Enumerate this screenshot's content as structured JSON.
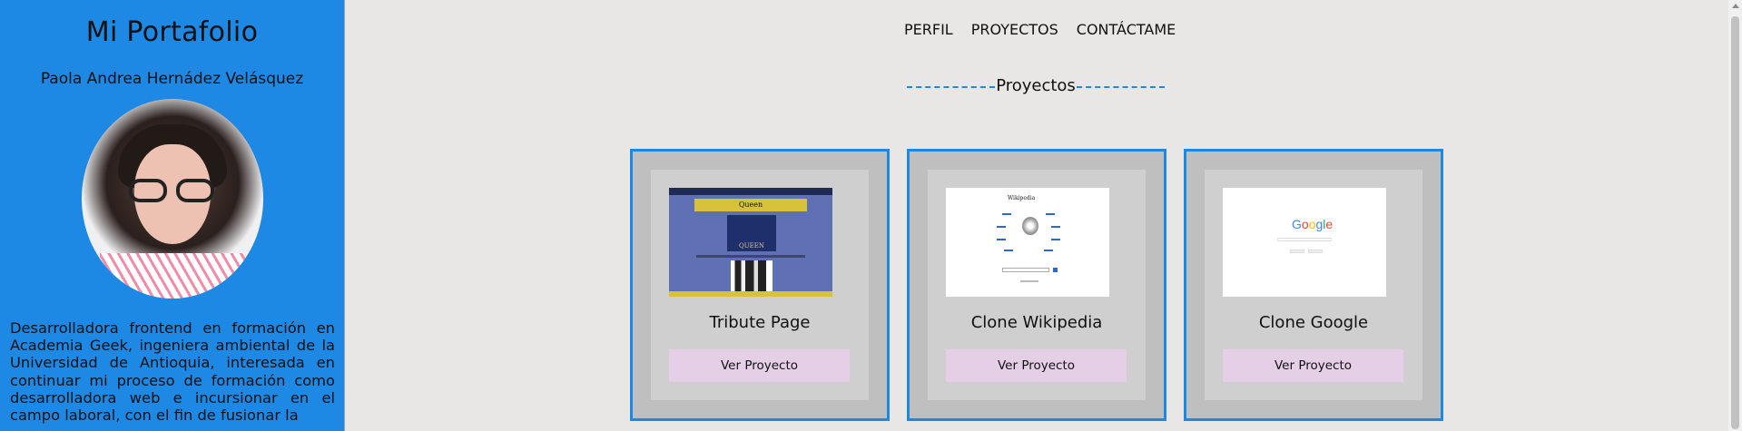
{
  "sidebar": {
    "title": "Mi Portafolio",
    "name": "Paola Andrea Hernádez Velásquez",
    "bio": "Desarrolladora frontend en formación en Academia Geek, ingeniera ambiental de la Universidad de Antioquia, interesada en continuar mi proceso de formación como desarrolladora web e incursionar en el campo laboral, con el fin de fusionar la"
  },
  "nav": {
    "items": [
      "PERFIL",
      "PROYECTOS",
      "CONTÁCTAME"
    ]
  },
  "section": {
    "title": "Proyectos"
  },
  "projects": [
    {
      "title": "Tribute Page",
      "button": "Ver Proyecto",
      "thumb_text": "Queen",
      "thumb_crest": "QUEEN"
    },
    {
      "title": "Clone Wikipedia",
      "button": "Ver Proyecto",
      "thumb_text": "Wikipedia"
    },
    {
      "title": "Clone Google",
      "button": "Ver Proyecto",
      "thumb_text": "Google"
    }
  ],
  "colors": {
    "accent": "#1e88e5",
    "background": "#e8e7e5",
    "card_outer": "#bfbfbf",
    "card_inner": "#cfcfcf",
    "button": "#e5cfe6"
  }
}
